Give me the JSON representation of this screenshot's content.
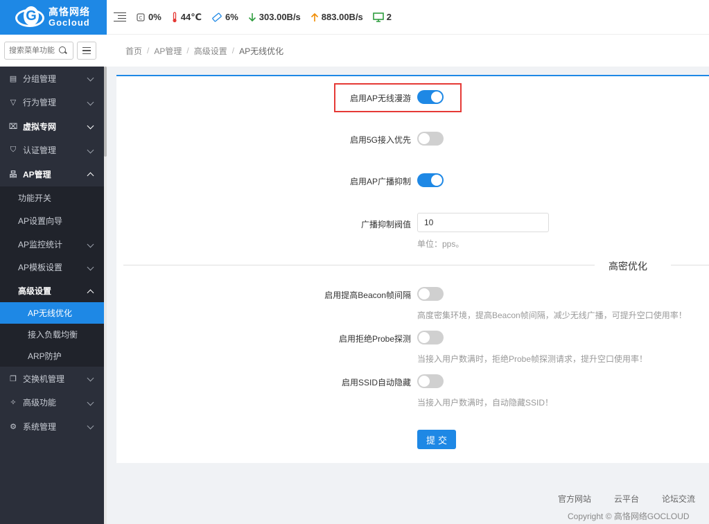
{
  "brand": {
    "name_cn": "高恪网络",
    "name_en": "Gocloud"
  },
  "search": {
    "placeholder": "搜索菜单功能"
  },
  "topbar": {
    "cpu": "0%",
    "temp": "44℃",
    "mem": "6%",
    "down": "303.00B/s",
    "up": "883.00B/s",
    "devices": "2"
  },
  "sidebar": {
    "items": [
      {
        "label": "分组管理",
        "icon": "document-icon"
      },
      {
        "label": "行为管理",
        "icon": "filter-icon"
      },
      {
        "label": "虚拟专网",
        "icon": "vpn-icon"
      },
      {
        "label": "认证管理",
        "icon": "shield-icon"
      },
      {
        "label": "AP管理",
        "icon": "topology-icon"
      },
      {
        "label": "交换机管理",
        "icon": "switch-icon"
      },
      {
        "label": "高级功能",
        "icon": "pin-icon"
      },
      {
        "label": "系统管理",
        "icon": "gear-icon"
      }
    ],
    "ap_sub": [
      "功能开关",
      "AP设置向导",
      "AP监控统计",
      "AP模板设置",
      "高级设置"
    ],
    "adv_sub": [
      "AP无线优化",
      "接入负载均衡",
      "ARP防护"
    ]
  },
  "breadcrumb": [
    "首页",
    "AP管理",
    "高级设置",
    "AP无线优化"
  ],
  "form": {
    "roaming_label": "启用AP无线漫游",
    "roaming_on": true,
    "prefer5g_label": "启用5G接入优先",
    "prefer5g_on": false,
    "bcast_label": "启用AP广播抑制",
    "bcast_on": true,
    "threshold_label": "广播抑制阀值",
    "threshold_value": "10",
    "threshold_unit": "单位：pps。",
    "section_title": "高密优化",
    "beacon_label": "启用提高Beacon帧间隔",
    "beacon_on": false,
    "beacon_hint": "高度密集环境，提高Beacon帧间隔，减少无线广播，可提升空口使用率！",
    "probe_label": "启用拒绝Probe探测",
    "probe_on": false,
    "probe_hint": "当接入用户数满时，拒绝Probe帧探测请求，提升空口使用率！",
    "ssid_label": "启用SSID自动隐藏",
    "ssid_on": false,
    "ssid_hint": "当接入用户数满时，自动隐藏SSID！",
    "submit": "提交"
  },
  "footer": {
    "links": [
      "官方网站",
      "云平台",
      "论坛交流"
    ],
    "copyright": "Copyright © 高恪网络GOCLOUD"
  },
  "colors": {
    "accent": "#1e88e5",
    "sidebar": "#2b2f3a",
    "highlight": "#e53935"
  }
}
